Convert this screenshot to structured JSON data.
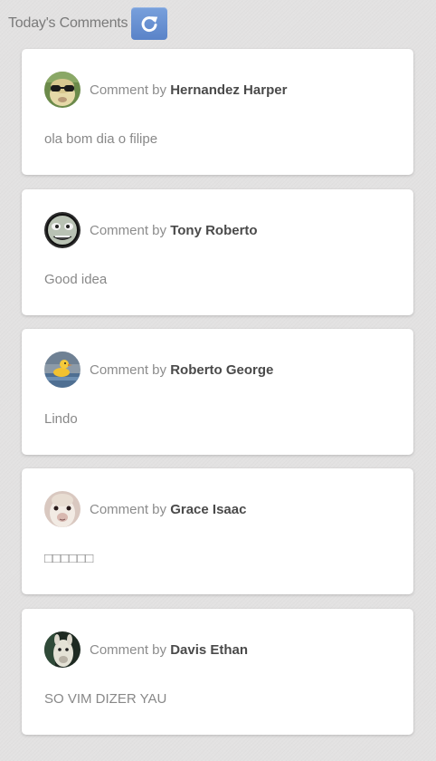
{
  "header": {
    "title": "Today's Comments",
    "refresh_icon": "refresh-icon"
  },
  "comment_prefix": "Comment by",
  "comments": [
    {
      "author": "Hernandez Harper",
      "text": "ola bom dia o filipe"
    },
    {
      "author": "Tony Roberto",
      "text": "Good idea"
    },
    {
      "author": "Roberto George",
      "text": "Lindo"
    },
    {
      "author": "Grace Isaac",
      "text": "□□□□□□"
    },
    {
      "author": "Davis Ethan",
      "text": "SO VIM DIZER YAU"
    }
  ],
  "colors": {
    "accent": "#6a92d4",
    "background": "#e3e2e2",
    "card": "#ffffff",
    "author": "#4a4a4a",
    "muted": "#8c8c8c"
  }
}
